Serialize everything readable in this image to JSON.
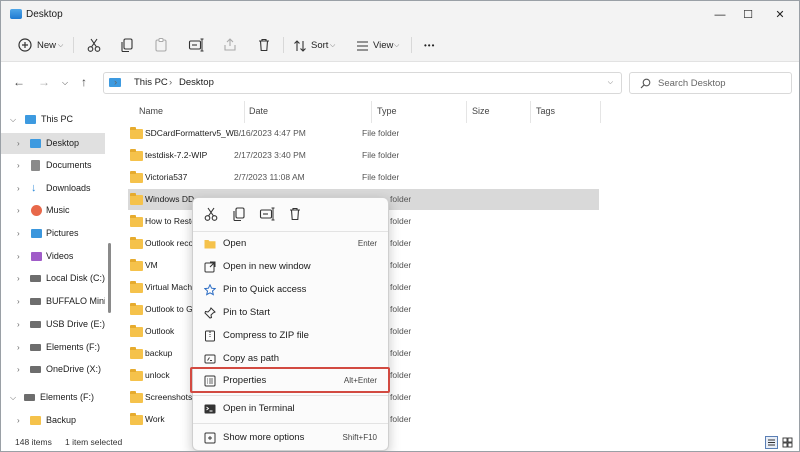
{
  "window": {
    "title": "Desktop",
    "minimize_icon": "—",
    "maximize_icon": "☐",
    "close_icon": "✕"
  },
  "toolbar": {
    "new_label": "New",
    "sort_label": "Sort",
    "view_label": "View",
    "more_icon": "•••"
  },
  "address": {
    "crumbs": [
      "This PC",
      "Desktop"
    ],
    "separator": "›"
  },
  "search": {
    "placeholder": "Search Desktop"
  },
  "nav": {
    "items": [
      {
        "label": "This PC",
        "icon": "pc-icon",
        "color": "#3d9ae0"
      },
      {
        "label": "Desktop",
        "icon": "desktop-icon",
        "color": "#3d9ae0"
      },
      {
        "label": "Documents",
        "icon": "documents-icon",
        "color": "#8a8a8a"
      },
      {
        "label": "Downloads",
        "icon": "downloads-icon",
        "color": "#2b88d8"
      },
      {
        "label": "Music",
        "icon": "music-icon",
        "color": "#e8684a"
      },
      {
        "label": "Pictures",
        "icon": "pictures-icon",
        "color": "#3a96dd"
      },
      {
        "label": "Videos",
        "icon": "videos-icon",
        "color": "#a05cc8"
      },
      {
        "label": "Local Disk (C:)",
        "icon": "drive-icon",
        "color": "#6d6d6d"
      },
      {
        "label": "BUFFALO MiniS",
        "icon": "drive-icon",
        "color": "#6d6d6d"
      },
      {
        "label": "USB Drive (E:)",
        "icon": "drive-icon",
        "color": "#6d6d6d"
      },
      {
        "label": "Elements (F:)",
        "icon": "drive-icon",
        "color": "#6d6d6d"
      },
      {
        "label": "OneDrive (X:)",
        "icon": "drive-icon",
        "color": "#6d6d6d"
      },
      {
        "label": "Elements (F:)",
        "icon": "drive-icon",
        "color": "#6d6d6d"
      },
      {
        "label": "Backup",
        "icon": "folder-icon",
        "color": "#f5c24b"
      }
    ]
  },
  "list": {
    "columns": [
      "Name",
      "Date",
      "Type",
      "Size",
      "Tags"
    ],
    "rows": [
      {
        "name": "SDCardFormatterv5_Wi...",
        "date": "3/16/2023 4:47 PM",
        "type": "File folder"
      },
      {
        "name": "testdisk-7.2-WIP",
        "date": "2/17/2023 3:40 PM",
        "type": "File folder"
      },
      {
        "name": "Victoria537",
        "date": "2/7/2023 11:08 AM",
        "type": "File folder"
      },
      {
        "name": "Windows DD",
        "date": "",
        "type": "folder"
      },
      {
        "name": "How to Resto",
        "date": "",
        "type": "folder"
      },
      {
        "name": "Outlook reco",
        "date": "",
        "type": "folder"
      },
      {
        "name": "VM",
        "date": "",
        "type": "folder"
      },
      {
        "name": "Virtual Mach",
        "date": "",
        "type": "folder"
      },
      {
        "name": "Outlook to G",
        "date": "",
        "type": "folder"
      },
      {
        "name": "Outlook",
        "date": "",
        "type": "folder"
      },
      {
        "name": "backup",
        "date": "",
        "type": "folder"
      },
      {
        "name": "unlock",
        "date": "",
        "type": "folder"
      },
      {
        "name": "Screenshots",
        "date": "",
        "type": "folder"
      },
      {
        "name": "Work",
        "date": "",
        "type": "folder"
      }
    ]
  },
  "status": {
    "count": "148 items",
    "selected": "1 item selected"
  },
  "context_menu": {
    "items": [
      {
        "label": "Open",
        "shortcut": "Enter",
        "icon": "folder-open-icon"
      },
      {
        "label": "Open in new window",
        "shortcut": "",
        "icon": "new-window-icon"
      },
      {
        "label": "Pin to Quick access",
        "shortcut": "",
        "icon": "star-icon"
      },
      {
        "label": "Pin to Start",
        "shortcut": "",
        "icon": "pin-icon"
      },
      {
        "label": "Compress to ZIP file",
        "shortcut": "",
        "icon": "zip-icon"
      },
      {
        "label": "Copy as path",
        "shortcut": "",
        "icon": "copy-path-icon"
      },
      {
        "label": "Properties",
        "shortcut": "Alt+Enter",
        "icon": "properties-icon"
      },
      {
        "label": "Open in Terminal",
        "shortcut": "",
        "icon": "terminal-icon"
      },
      {
        "label": "Show more options",
        "shortcut": "Shift+F10",
        "icon": "more-options-icon"
      }
    ]
  },
  "colors": {
    "highlight": "#d24a41",
    "selection": "#d9d9d9"
  }
}
